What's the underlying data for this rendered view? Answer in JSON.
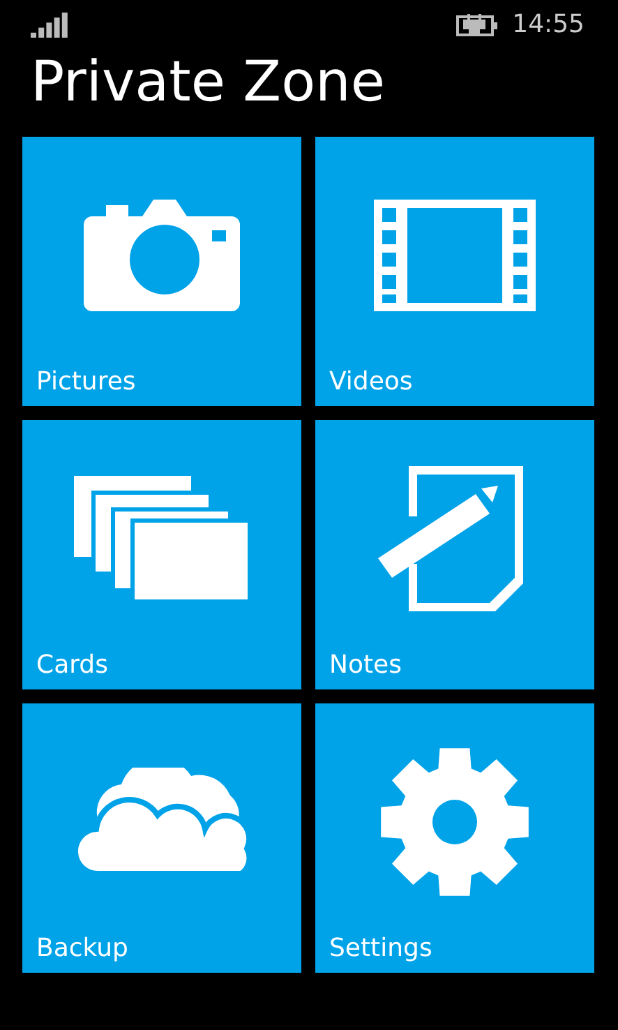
{
  "status_bar": {
    "time": "14:55"
  },
  "title": "Private Zone",
  "tiles": [
    {
      "kind": "pictures",
      "label": "Pictures"
    },
    {
      "kind": "videos",
      "label": "Videos"
    },
    {
      "kind": "cards",
      "label": "Cards"
    },
    {
      "kind": "notes",
      "label": "Notes"
    },
    {
      "kind": "backup",
      "label": "Backup"
    },
    {
      "kind": "settings",
      "label": "Settings"
    }
  ]
}
